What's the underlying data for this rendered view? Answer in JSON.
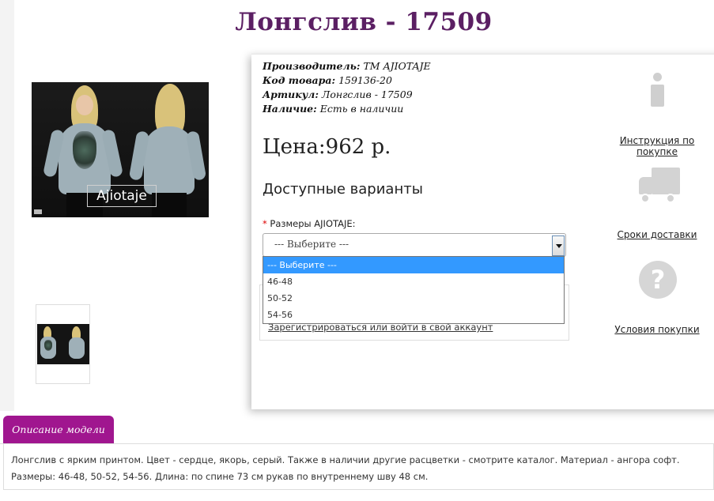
{
  "product": {
    "title": "Лонгслив - 17509",
    "image_brand_text": "Ajiotaje"
  },
  "meta": {
    "manufacturer_label": "Производитель:",
    "manufacturer_value": "ТМ AJIOTAJE",
    "code_label": "Код товара:",
    "code_value": "159136-20",
    "article_label": "Артикул:",
    "article_value": "Лонгслив - 17509",
    "availability_label": "Наличие:",
    "availability_value": "Есть в наличии"
  },
  "price": {
    "text": "Цена:962 р."
  },
  "variants": {
    "heading": "Доступные варианты",
    "size_required": "*",
    "size_label": "Размеры AJIOTAJE:",
    "selected": "--- Выберите ---",
    "options": [
      "--- Выберите ---",
      "46-48",
      "50-52",
      "54-56"
    ],
    "highlighted_index": 0
  },
  "login": {
    "link": "Зарегистрироваться или войти в свой аккаунт"
  },
  "sidebar": {
    "instruction_link": "Инструкция по покупке",
    "delivery_link": "Сроки доставки",
    "terms_link": "Условия покупки",
    "help_glyph": "?"
  },
  "description": {
    "tab_label": "Описание модели",
    "text": "Лонгслив с ярким принтом. Цвет - сердце, якорь, серый. Также в наличии другие расцветки - смотрите каталог. Материал - ангора софт. Размеры: 46-48, 50-52, 54-56. Длина: по спине 73 см рукав по внутреннему шву 48 см."
  },
  "colors": {
    "title": "#5b1f63",
    "tab": "#a0168f",
    "highlight": "#3399ff",
    "icon_gray": "#d3d3d3"
  }
}
